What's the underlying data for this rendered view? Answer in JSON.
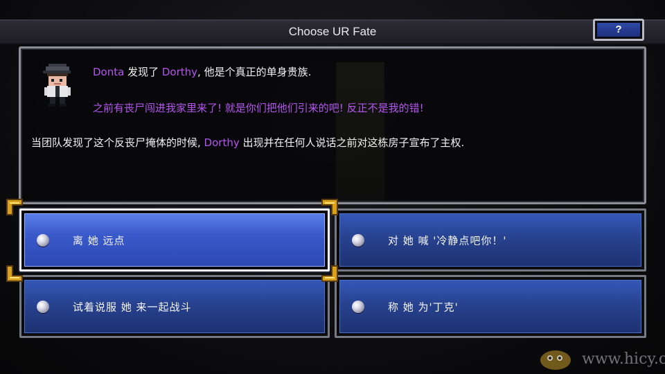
{
  "header": {
    "title": "Choose UR Fate",
    "help_label": "?"
  },
  "story": {
    "line1": {
      "name": "Donta",
      "mid": " 发现了 ",
      "name2": "Dorthy",
      "rest": ", 他是个真正的单身贵族."
    },
    "line2": "之前有丧尸闯进我家里来了! 就是你们把他们引来的吧! 反正不是我的错!",
    "line3": {
      "pre": "当团队发现了这个反丧尸掩体的时候, ",
      "name": "Dorthy",
      "rest": " 出现并在任何人说话之前对这栋房子宣布了主权."
    }
  },
  "choices": [
    {
      "label": "离 她 远点",
      "selected": true
    },
    {
      "label": "对 她 喊 '冷静点吧你！'",
      "selected": false
    },
    {
      "label": "试着说服 她 来一起战斗",
      "selected": false
    },
    {
      "label": "称 她 为'丁克'",
      "selected": false
    }
  ],
  "watermark": {
    "text": "www.hicy.cn"
  },
  "colors": {
    "name_purple": "#b455ef",
    "button_blue": "#27428f",
    "selected_blue": "#3a5acb",
    "cursor_gold": "#d9a21c"
  }
}
